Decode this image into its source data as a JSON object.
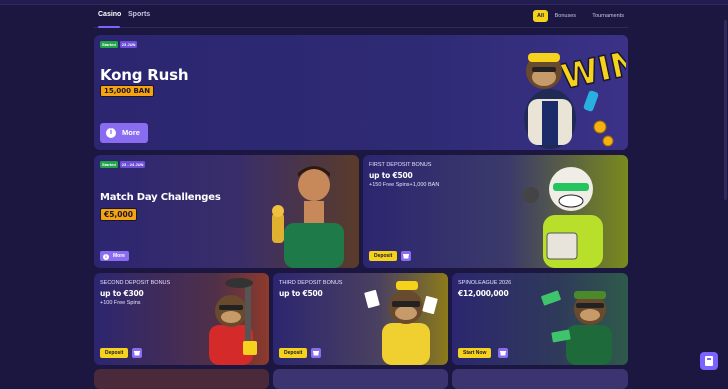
{
  "nav": {
    "tabs": [
      {
        "label": "Casino",
        "active": true
      },
      {
        "label": "Sports",
        "active": false
      }
    ],
    "filters": [
      {
        "label": "All",
        "active": true
      },
      {
        "label": "Bonuses",
        "active": false
      },
      {
        "label": "Tournaments",
        "active": false
      }
    ]
  },
  "cards": {
    "kong": {
      "status": "Started",
      "date": "23 JUN",
      "title": "Kong Rush",
      "prize": "15,000 BAN",
      "button": "More"
    },
    "match": {
      "status": "Started",
      "date": "23 - 24 JUN",
      "title": "Match Day Challenges",
      "prize": "€5,000",
      "button": "More"
    },
    "first": {
      "eyebrow": "FIRST DEPOSIT BONUS",
      "title": "up to €500",
      "sub": "+150 Free Spins+1,000 BAN",
      "button": "Deposit"
    },
    "second": {
      "eyebrow": "SECOND DEPOSIT BONUS",
      "title": "up to €300",
      "sub": "+100 Free Spins",
      "button": "Deposit"
    },
    "third": {
      "eyebrow": "THIRD DEPOSIT BONUS",
      "title": "up to €500",
      "button": "Deposit"
    },
    "league": {
      "eyebrow": "SPINOLEAGUE 2026",
      "title": "€12,000,000",
      "button": "Start Now"
    }
  },
  "art": {
    "win_text": "WIN"
  },
  "colors": {
    "background": "#1b1740",
    "card": "#2b2567",
    "accent_yellow": "#f5d31c",
    "accent_purple": "#8a6cf0",
    "prize_orange": "#f5a30e",
    "started_green": "#21a34a"
  },
  "icons": [
    "info-icon",
    "gift-icon",
    "chat-icon",
    "calendar-icon"
  ]
}
